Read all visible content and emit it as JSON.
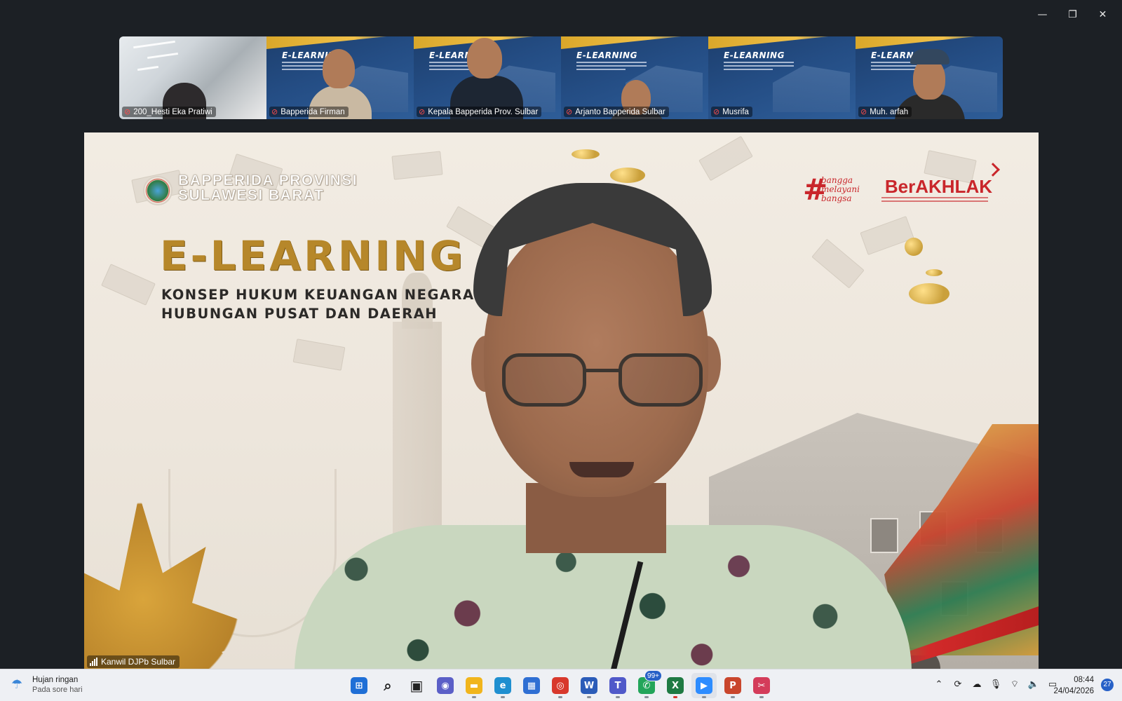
{
  "window": {
    "controls": {
      "minimize": "—",
      "restore": "❐",
      "close": "✕"
    }
  },
  "gallery": [
    {
      "name": "200_Hesti Eka Pratiwi",
      "kind": "room",
      "muted": true
    },
    {
      "name": "Bapperida Firman",
      "kind": "slide",
      "muted": true,
      "slide_title": "E-LEARNING"
    },
    {
      "name": "Kepala Bapperida Prov. Sulbar",
      "kind": "slide",
      "muted": true,
      "slide_title": "E-LEARNING"
    },
    {
      "name": "Arjanto Bapperida Sulbar",
      "kind": "slide",
      "muted": true,
      "slide_title": "E-LEARNING"
    },
    {
      "name": "Musrifa",
      "kind": "slide",
      "muted": true,
      "slide_title": "E-LEARNING"
    },
    {
      "name": "Muh. arfah",
      "kind": "slide",
      "muted": true,
      "slide_title": "E-LEARNING"
    }
  ],
  "main_video": {
    "speaker_name": "Kanwil DJPb Sulbar",
    "background": {
      "org_line1": "BAPPERIDA PROVINSI",
      "org_line2": "SULAWESI BARAT",
      "title": "E-LEARNING",
      "subtitle_line1": "KONSEP HUKUM KEUANGAN NEGARA TE",
      "subtitle_line2": "HUBUNGAN PUSAT DAN DAERAH",
      "tagline_words": "bangga melayani bangsa",
      "brand": "BerAKHLAK"
    }
  },
  "taskbar": {
    "weather": {
      "icon": "umbrella-rain-icon",
      "condition": "Hujan ringan",
      "detail": "Pada sore hari"
    },
    "apps": [
      {
        "id": "start",
        "icon": "windows-start-icon",
        "color": "#1f6fd6"
      },
      {
        "id": "search",
        "icon": "search-icon",
        "color": "#222222"
      },
      {
        "id": "taskview",
        "icon": "task-view-icon",
        "color": "#222222"
      },
      {
        "id": "chat",
        "icon": "chat-icon",
        "color": "#5b5fc7"
      },
      {
        "id": "explorer",
        "icon": "folder-icon",
        "color": "#f1b51c",
        "running": true
      },
      {
        "id": "edge",
        "icon": "edge-icon",
        "color": "#1f8fd0",
        "running": true
      },
      {
        "id": "store",
        "icon": "store-icon",
        "color": "#2f6fd3"
      },
      {
        "id": "chrome",
        "icon": "chrome-icon",
        "color": "#d8382c",
        "running": true
      },
      {
        "id": "word",
        "icon": "word-icon",
        "color": "#2b5cb8",
        "running": true
      },
      {
        "id": "teams",
        "icon": "teams-icon",
        "color": "#5059c9",
        "running": true
      },
      {
        "id": "whatsapp",
        "icon": "whatsapp-icon",
        "color": "#23a55a",
        "running": true,
        "badge": "99+"
      },
      {
        "id": "excel",
        "icon": "excel-icon",
        "color": "#1f7a43",
        "running": true,
        "focused": true
      },
      {
        "id": "zoom",
        "icon": "zoom-icon",
        "color": "#2d8cff",
        "running": true,
        "active": true
      },
      {
        "id": "powerpoint",
        "icon": "powerpoint-icon",
        "color": "#c9462c",
        "running": true
      },
      {
        "id": "snipping",
        "icon": "snipping-tool-icon",
        "color": "#d43c5a",
        "running": true
      }
    ],
    "tray": [
      {
        "id": "chevron",
        "icon": "chevron-up-icon",
        "glyph": "⌃"
      },
      {
        "id": "sync",
        "icon": "sync-icon",
        "glyph": "⟳"
      },
      {
        "id": "cloud",
        "icon": "onedrive-icon",
        "glyph": "☁"
      },
      {
        "id": "mic",
        "icon": "microphone-icon",
        "glyph": "🎙"
      },
      {
        "id": "wifi",
        "icon": "wifi-icon",
        "glyph": "⌔"
      },
      {
        "id": "volume",
        "icon": "volume-icon",
        "glyph": "🔈"
      },
      {
        "id": "battery",
        "icon": "battery-icon",
        "glyph": "▭"
      }
    ],
    "time": "08:44",
    "date": "24/04/2026",
    "notifications": "27"
  }
}
